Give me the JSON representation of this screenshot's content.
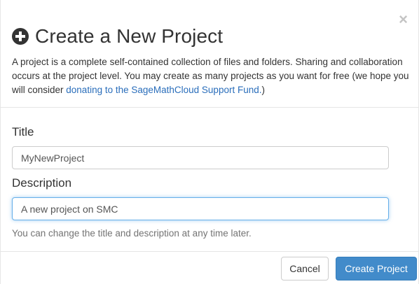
{
  "dialog": {
    "close_symbol": "×",
    "title_icon": "plus-circle-icon",
    "title": "Create a New Project",
    "intro_text": "A project is a complete self-contained collection of files and folders. Sharing and collaboration occurs at the project level. You may create as many projects as you want for free (we hope you will consider ",
    "intro_link": "donating to the SageMathCloud Support Fund.",
    "intro_suffix": ")"
  },
  "form": {
    "title_label": "Title",
    "title_value": "MyNewProject",
    "description_label": "Description",
    "description_value": "A new project on SMC",
    "help_text": "You can change the title and description at any time later."
  },
  "footer": {
    "cancel_label": "Cancel",
    "create_label": "Create Project"
  },
  "colors": {
    "primary": "#428bca",
    "link": "#2a6ebb",
    "focus": "#66afe9"
  }
}
